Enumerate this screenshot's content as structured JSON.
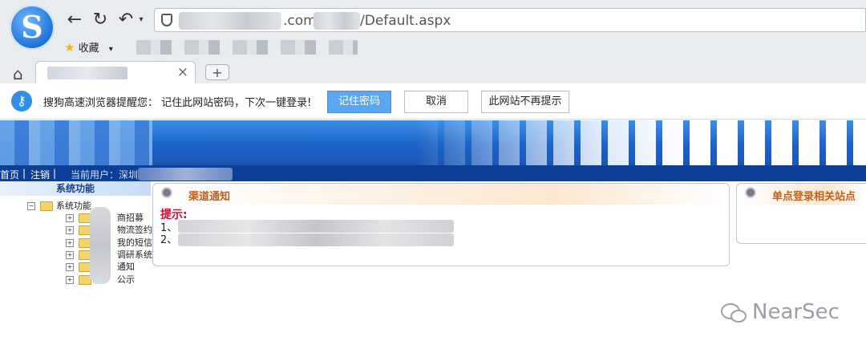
{
  "browser": {
    "address_visible_parts": [
      ".com/",
      "/Default.aspx"
    ],
    "bookmarks_label": "收藏",
    "new_tab_label": "+",
    "close_tab_label": "×",
    "nav_icons": [
      "back-icon",
      "refresh-icon",
      "undo-icon",
      "dropdown-icon"
    ]
  },
  "notice": {
    "message": "搜狗高速浏览器提醒您：  记住此网站密码，下次一键登录!",
    "remember_label": "记住密码",
    "cancel_label": "取消",
    "never_label": "此网站不再提示"
  },
  "menubar": {
    "home": "首页",
    "logout": "注销",
    "current_user": "当前用户：深圳市"
  },
  "sidebar": {
    "title": "系统功能",
    "root": "系统功能",
    "items": [
      "商招募",
      "物流签约",
      "我的短信功",
      "调研系统",
      "通知",
      "公示"
    ]
  },
  "notice_panel": {
    "title": "渠道通知",
    "tip_label": "提示:",
    "line1_prefix": "1、",
    "line2_prefix": "2、"
  },
  "sso_panel": {
    "title": "单点登录相关站点"
  },
  "watermark": "NearSec"
}
